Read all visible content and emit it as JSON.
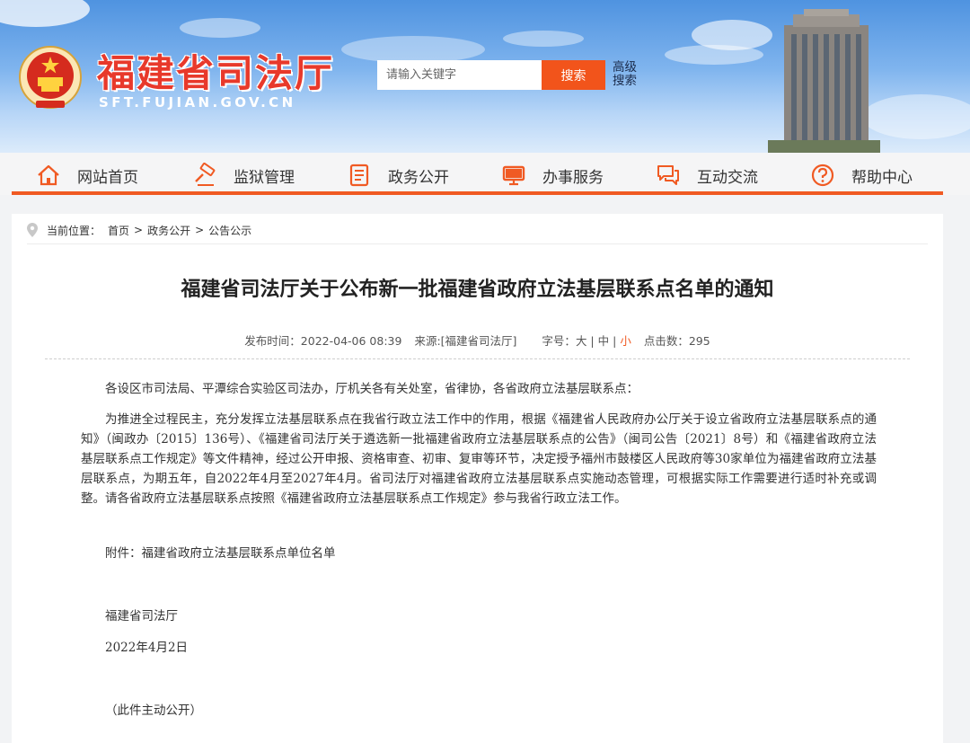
{
  "header": {
    "site_name": "福建省司法厅",
    "site_domain": "SFT.FUJIAN.GOV.CN",
    "search": {
      "placeholder": "请输入关键字",
      "button": "搜索"
    },
    "advanced_search": "高级搜索"
  },
  "nav": [
    {
      "label": "网站首页",
      "icon": "home-icon"
    },
    {
      "label": "监狱管理",
      "icon": "gavel-icon"
    },
    {
      "label": "政务公开",
      "icon": "document-icon"
    },
    {
      "label": "办事服务",
      "icon": "monitor-icon"
    },
    {
      "label": "互动交流",
      "icon": "chat-icon"
    },
    {
      "label": "帮助中心",
      "icon": "help-icon"
    }
  ],
  "colors": {
    "accent": "#f05a23",
    "brand_red": "#e8392b",
    "sky_blue": "#4f93e0"
  },
  "breadcrumb": {
    "prefix": "当前位置：",
    "items": [
      "首页",
      "政务公开",
      "公告公示"
    ],
    "separator": ">"
  },
  "article": {
    "title": "福建省司法厅关于公布新一批福建省政府立法基层联系点名单的通知",
    "meta": {
      "publish_label": "发布时间：",
      "publish_time": "2022-04-06 08:39",
      "source_label": "来源:",
      "source": "[福建省司法厅]",
      "font_label": "字号：",
      "font_sizes": [
        "大",
        "中",
        "小"
      ],
      "clicks_label": "点击数：",
      "clicks": "295"
    },
    "paragraphs": [
      "各设区市司法局、平潭综合实验区司法办，厅机关各有关处室，省律协，各省政府立法基层联系点：",
      "为推进全过程民主，充分发挥立法基层联系点在我省行政立法工作中的作用，根据《福建省人民政府办公厅关于设立省政府立法基层联系点的通知》（闽政办〔2015〕136号）、《福建省司法厅关于遴选新一批福建省政府立法基层联系点的公告》（闽司公告〔2021〕8号）和《福建省政府立法基层联系点工作规定》等文件精神，经过公开申报、资格审查、初审、复审等环节，决定授予福州市鼓楼区人民政府等30家单位为福建省政府立法基层联系点，为期五年，自2022年4月至2027年4月。省司法厅对福建省政府立法基层联系点实施动态管理，可根据实际工作需要进行适时补充或调整。请各省政府立法基层联系点按照《福建省政府立法基层联系点工作规定》参与我省行政立法工作。",
      "附件：福建省政府立法基层联系点单位名单",
      "福建省司法厅",
      "2022年4月2日",
      "（此件主动公开）"
    ]
  }
}
